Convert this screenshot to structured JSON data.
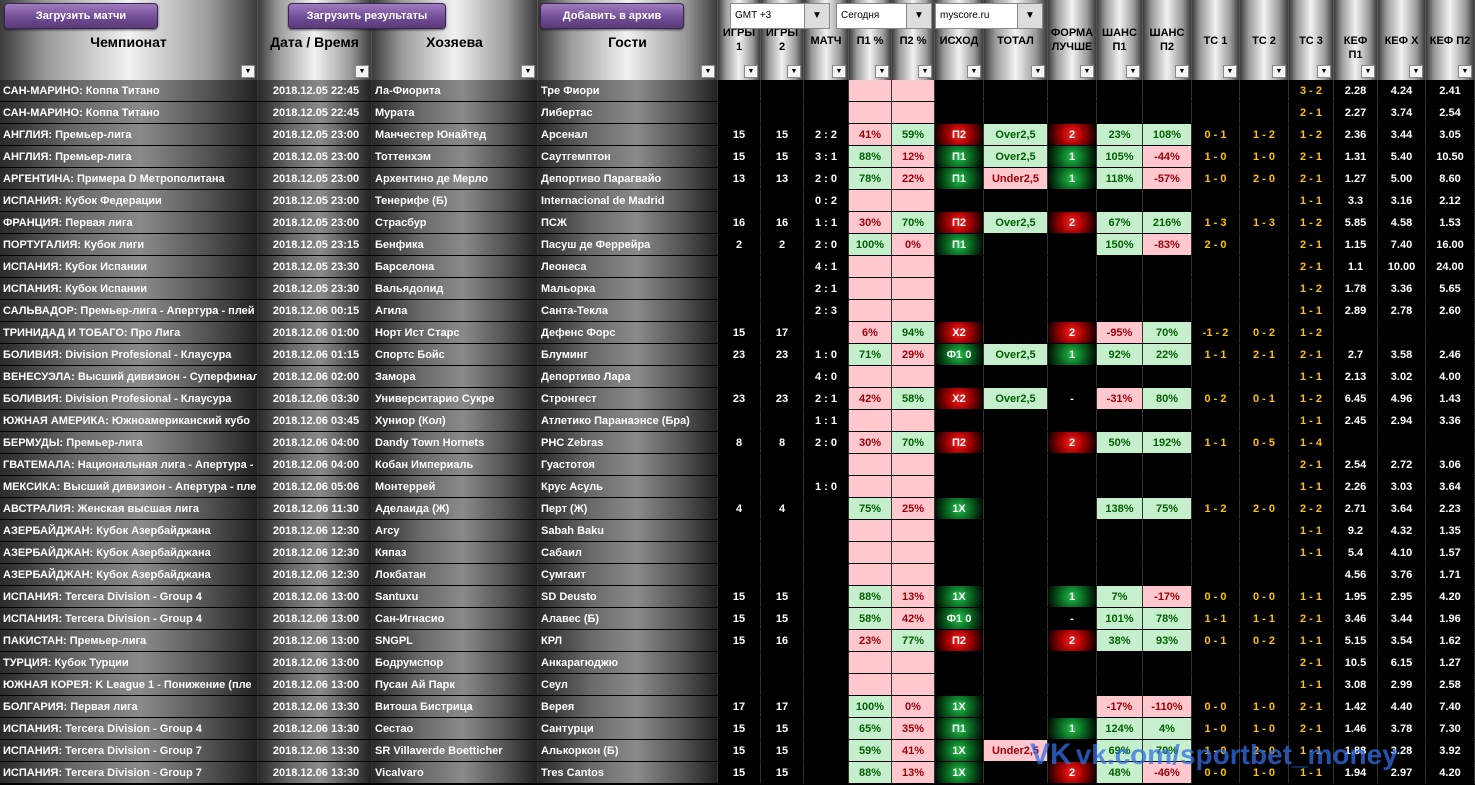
{
  "buttons": {
    "load_matches": "Загрузить матчи",
    "load_results": "Загрузить результаты",
    "archive": "Добавить в архив"
  },
  "dropdowns": {
    "timezone": "GMT +3",
    "day": "Сегодня",
    "source": "myscore.ru",
    "arrow": "▼"
  },
  "filter_glyph": "▼",
  "columns": [
    {
      "key": "champ",
      "label": "Чемпионат"
    },
    {
      "key": "date",
      "label": "Дата / Время"
    },
    {
      "key": "home",
      "label": "Хозяева"
    },
    {
      "key": "away",
      "label": "Гости"
    },
    {
      "key": "g1",
      "label": "ИГРЫ 1"
    },
    {
      "key": "g2",
      "label": "ИГРЫ 2"
    },
    {
      "key": "match",
      "label": "МАТЧ"
    },
    {
      "key": "p1",
      "label": "П1 %"
    },
    {
      "key": "p2",
      "label": "П2 %"
    },
    {
      "key": "out",
      "label": "ИСХОД"
    },
    {
      "key": "total",
      "label": "ТОТАЛ"
    },
    {
      "key": "form",
      "label": "ФОРМА ЛУЧШЕ"
    },
    {
      "key": "ch1",
      "label": "ШАНС П1"
    },
    {
      "key": "ch2",
      "label": "ШАНС П2"
    },
    {
      "key": "ts1",
      "label": "ТС 1"
    },
    {
      "key": "ts2",
      "label": "ТС 2"
    },
    {
      "key": "ts3",
      "label": "ТС 3"
    },
    {
      "key": "k1",
      "label": "КЕФ П1"
    },
    {
      "key": "kx",
      "label": "КЕФ Х"
    },
    {
      "key": "k2",
      "label": "КЕФ П2"
    }
  ],
  "rows": [
    {
      "champ": "САН-МАРИНО: Коппа Титано",
      "date": "2018.12.05 22:45",
      "home": "Ла-Фиорита",
      "away": "Тре Фиори",
      "g1": "",
      "g2": "",
      "match": "",
      "p1": "",
      "p2": "",
      "out": "",
      "total": "",
      "form": "",
      "ch1": "",
      "ch2": "",
      "ts1": "",
      "ts2": "",
      "ts3": "3 - 2",
      "k1": "2.28",
      "kx": "4.24",
      "k2": "2.41"
    },
    {
      "champ": "САН-МАРИНО: Коппа Титано",
      "date": "2018.12.05 22:45",
      "home": "Мурата",
      "away": "Либертас",
      "g1": "",
      "g2": "",
      "match": "",
      "p1": "",
      "p2": "",
      "out": "",
      "total": "",
      "form": "",
      "ch1": "",
      "ch2": "",
      "ts1": "",
      "ts2": "",
      "ts3": "2 - 1",
      "k1": "2.27",
      "kx": "3.74",
      "k2": "2.54"
    },
    {
      "champ": "АНГЛИЯ: Премьер-лига",
      "date": "2018.12.05 23:00",
      "home": "Манчестер Юнайтед",
      "away": "Арсенал",
      "g1": "15",
      "g2": "15",
      "match": "2 : 2",
      "p1": "41%",
      "p2": "59%",
      "out": "П2",
      "total": "Over2,5",
      "form": "2",
      "ch1": "23%",
      "ch2": "108%",
      "ts1": "0 - 1",
      "ts2": "1 - 2",
      "ts3": "1 - 2",
      "k1": "2.36",
      "kx": "3.44",
      "k2": "3.05"
    },
    {
      "champ": "АНГЛИЯ: Премьер-лига",
      "date": "2018.12.05 23:00",
      "home": "Тоттенхэм",
      "away": "Саутгемптон",
      "g1": "15",
      "g2": "15",
      "match": "3 : 1",
      "p1": "88%",
      "p2": "12%",
      "out": "П1",
      "total": "Over2,5",
      "form": "1",
      "ch1": "105%",
      "ch2": "-44%",
      "ts1": "1 - 0",
      "ts2": "1 - 0",
      "ts3": "2 - 1",
      "k1": "1.31",
      "kx": "5.40",
      "k2": "10.50"
    },
    {
      "champ": "АРГЕНТИНА: Примера D Метрополитана",
      "date": "2018.12.05 23:00",
      "home": "Архентино де Мерло",
      "away": "Депортиво Парагвайо",
      "g1": "13",
      "g2": "13",
      "match": "2 : 0",
      "p1": "78%",
      "p2": "22%",
      "out": "П1",
      "total": "Under2,5",
      "form": "1",
      "ch1": "118%",
      "ch2": "-57%",
      "ts1": "1 - 0",
      "ts2": "2 - 0",
      "ts3": "2 - 1",
      "k1": "1.27",
      "kx": "5.00",
      "k2": "8.60"
    },
    {
      "champ": "ИСПАНИЯ: Кубок Федерации",
      "date": "2018.12.05 23:00",
      "home": "Тенерифе (Б)",
      "away": "Internacional de Madrid",
      "g1": "",
      "g2": "",
      "match": "0 : 2",
      "p1": "",
      "p2": "",
      "out": "",
      "total": "",
      "form": "",
      "ch1": "",
      "ch2": "",
      "ts1": "",
      "ts2": "",
      "ts3": "1 - 1",
      "k1": "3.3",
      "kx": "3.16",
      "k2": "2.12"
    },
    {
      "champ": "ФРАНЦИЯ: Первая лига",
      "date": "2018.12.05 23:00",
      "home": "Страсбур",
      "away": "ПСЖ",
      "g1": "16",
      "g2": "16",
      "match": "1 : 1",
      "p1": "30%",
      "p2": "70%",
      "out": "П2",
      "total": "Over2,5",
      "form": "2",
      "ch1": "67%",
      "ch2": "216%",
      "ts1": "1 - 3",
      "ts2": "1 - 3",
      "ts3": "1 - 2",
      "k1": "5.85",
      "kx": "4.58",
      "k2": "1.53"
    },
    {
      "champ": "ПОРТУГАЛИЯ: Кубок лиги",
      "date": "2018.12.05 23:15",
      "home": "Бенфика",
      "away": "Пасуш де Феррейра",
      "g1": "2",
      "g2": "2",
      "match": "2 : 0",
      "p1": "100%",
      "p2": "0%",
      "out": "П1",
      "total": "",
      "form": "",
      "ch1": "150%",
      "ch2": "-83%",
      "ts1": "2 - 0",
      "ts2": "",
      "ts3": "2 - 1",
      "k1": "1.15",
      "kx": "7.40",
      "k2": "16.00"
    },
    {
      "champ": "ИСПАНИЯ: Кубок Испании",
      "date": "2018.12.05 23:30",
      "home": "Барселона",
      "away": "Леонеса",
      "g1": "",
      "g2": "",
      "match": "4 : 1",
      "p1": "",
      "p2": "",
      "out": "",
      "total": "",
      "form": "",
      "ch1": "",
      "ch2": "",
      "ts1": "",
      "ts2": "",
      "ts3": "2 - 1",
      "k1": "1.1",
      "kx": "10.00",
      "k2": "24.00"
    },
    {
      "champ": "ИСПАНИЯ: Кубок Испании",
      "date": "2018.12.05 23:30",
      "home": "Вальядолид",
      "away": "Мальорка",
      "g1": "",
      "g2": "",
      "match": "2 : 1",
      "p1": "",
      "p2": "",
      "out": "",
      "total": "",
      "form": "",
      "ch1": "",
      "ch2": "",
      "ts1": "",
      "ts2": "",
      "ts3": "1 - 2",
      "k1": "1.78",
      "kx": "3.36",
      "k2": "5.65"
    },
    {
      "champ": "САЛЬВАДОР: Премьер-лига - Апертура - плей",
      "date": "2018.12.06 00:15",
      "home": "Агила",
      "away": "Санта-Текла",
      "g1": "",
      "g2": "",
      "match": "2 : 3",
      "p1": "",
      "p2": "",
      "out": "",
      "total": "",
      "form": "",
      "ch1": "",
      "ch2": "",
      "ts1": "",
      "ts2": "",
      "ts3": "1 - 1",
      "k1": "2.89",
      "kx": "2.78",
      "k2": "2.60"
    },
    {
      "champ": "ТРИНИДАД И ТОБАГО: Про Лига",
      "date": "2018.12.06 01:00",
      "home": "Норт Ист Старс",
      "away": "Дефенс Форс",
      "g1": "15",
      "g2": "17",
      "match": "",
      "p1": "6%",
      "p2": "94%",
      "out": "Х2",
      "total": "",
      "form": "2",
      "ch1": "-95%",
      "ch2": "70%",
      "ts1": "-1 - 2",
      "ts2": "0 - 2",
      "ts3": "1 - 2",
      "k1": "",
      "kx": "",
      "k2": ""
    },
    {
      "champ": "БОЛИВИЯ: Division Profesional - Клаусура",
      "date": "2018.12.06 01:15",
      "home": "Спортс Бойс",
      "away": "Блуминг",
      "g1": "23",
      "g2": "23",
      "match": "1 : 0",
      "p1": "71%",
      "p2": "29%",
      "out": "Ф1 0",
      "total": "Over2,5",
      "form": "1",
      "ch1": "92%",
      "ch2": "22%",
      "ts1": "1 - 1",
      "ts2": "2 - 1",
      "ts3": "2 - 1",
      "k1": "2.7",
      "kx": "3.58",
      "k2": "2.46"
    },
    {
      "champ": "ВЕНЕСУЭЛА: Высший дивизион - Суперфинал",
      "date": "2018.12.06 02:00",
      "home": "Замора",
      "away": "Депортиво Лара",
      "g1": "",
      "g2": "",
      "match": "4 : 0",
      "p1": "",
      "p2": "",
      "out": "",
      "total": "",
      "form": "",
      "ch1": "",
      "ch2": "",
      "ts1": "",
      "ts2": "",
      "ts3": "1 - 1",
      "k1": "2.13",
      "kx": "3.02",
      "k2": "4.00"
    },
    {
      "champ": "БОЛИВИЯ: Division Profesional - Клаусура",
      "date": "2018.12.06 03:30",
      "home": "Университарио Сукре",
      "away": "Стронгест",
      "g1": "23",
      "g2": "23",
      "match": "2 : 1",
      "p1": "42%",
      "p2": "58%",
      "out": "Х2",
      "total": "Over2,5",
      "form": "-",
      "ch1": "-31%",
      "ch2": "80%",
      "ts1": "0 - 2",
      "ts2": "0 - 1",
      "ts3": "1 - 2",
      "k1": "6.45",
      "kx": "4.96",
      "k2": "1.43"
    },
    {
      "champ": "ЮЖНАЯ АМЕРИКА: Южноамериканский кубо",
      "date": "2018.12.06 03:45",
      "home": "Хуниор (Кол)",
      "away": "Атлетико Паранаэнсе (Бра)",
      "g1": "",
      "g2": "",
      "match": "1 : 1",
      "p1": "",
      "p2": "",
      "out": "",
      "total": "",
      "form": "",
      "ch1": "",
      "ch2": "",
      "ts1": "",
      "ts2": "",
      "ts3": "1 - 1",
      "k1": "2.45",
      "kx": "2.94",
      "k2": "3.36"
    },
    {
      "champ": "БЕРМУДЫ: Премьер-лига",
      "date": "2018.12.06 04:00",
      "home": "Dandy Town Hornets",
      "away": "PHC Zebras",
      "g1": "8",
      "g2": "8",
      "match": "2 : 0",
      "p1": "30%",
      "p2": "70%",
      "out": "П2",
      "total": "",
      "form": "2",
      "ch1": "50%",
      "ch2": "192%",
      "ts1": "1 - 1",
      "ts2": "0 - 5",
      "ts3": "1 - 4",
      "k1": "",
      "kx": "",
      "k2": ""
    },
    {
      "champ": "ГВАТЕМАЛА: Национальная лига - Апертура -",
      "date": "2018.12.06 04:00",
      "home": "Кобан Империаль",
      "away": "Гуастотоя",
      "g1": "",
      "g2": "",
      "match": "",
      "p1": "",
      "p2": "",
      "out": "",
      "total": "",
      "form": "",
      "ch1": "",
      "ch2": "",
      "ts1": "",
      "ts2": "",
      "ts3": "2 - 1",
      "k1": "2.54",
      "kx": "2.72",
      "k2": "3.06"
    },
    {
      "champ": "МЕКСИКА: Высший дивизион - Апертура - пле",
      "date": "2018.12.06 05:06",
      "home": "Монтеррей",
      "away": "Крус Асуль",
      "g1": "",
      "g2": "",
      "match": "1 : 0",
      "p1": "",
      "p2": "",
      "out": "",
      "total": "",
      "form": "",
      "ch1": "",
      "ch2": "",
      "ts1": "",
      "ts2": "",
      "ts3": "1 - 1",
      "k1": "2.26",
      "kx": "3.03",
      "k2": "3.64"
    },
    {
      "champ": "АВСТРАЛИЯ: Женская высшая лига",
      "date": "2018.12.06 11:30",
      "home": "Аделаида (Ж)",
      "away": "Перт (Ж)",
      "g1": "4",
      "g2": "4",
      "match": "",
      "p1": "75%",
      "p2": "25%",
      "out": "1Х",
      "total": "",
      "form": "",
      "ch1": "138%",
      "ch2": "75%",
      "ts1": "1 - 2",
      "ts2": "2 - 0",
      "ts3": "2 - 2",
      "k1": "2.71",
      "kx": "3.64",
      "k2": "2.23"
    },
    {
      "champ": "АЗЕРБАЙДЖАН: Кубок Азербайджана",
      "date": "2018.12.06 12:30",
      "home": "Arcy",
      "away": "Sabah Baku",
      "g1": "",
      "g2": "",
      "match": "",
      "p1": "",
      "p2": "",
      "out": "",
      "total": "",
      "form": "",
      "ch1": "",
      "ch2": "",
      "ts1": "",
      "ts2": "",
      "ts3": "1 - 1",
      "k1": "9.2",
      "kx": "4.32",
      "k2": "1.35"
    },
    {
      "champ": "АЗЕРБАЙДЖАН: Кубок Азербайджана",
      "date": "2018.12.06 12:30",
      "home": "Кяпаз",
      "away": "Сабаил",
      "g1": "",
      "g2": "",
      "match": "",
      "p1": "",
      "p2": "",
      "out": "",
      "total": "",
      "form": "",
      "ch1": "",
      "ch2": "",
      "ts1": "",
      "ts2": "",
      "ts3": "1 - 1",
      "k1": "5.4",
      "kx": "4.10",
      "k2": "1.57"
    },
    {
      "champ": "АЗЕРБАЙДЖАН: Кубок Азербайджана",
      "date": "2018.12.06 12:30",
      "home": "Локбатан",
      "away": "Сумгаит",
      "g1": "",
      "g2": "",
      "match": "",
      "p1": "",
      "p2": "",
      "out": "",
      "total": "",
      "form": "",
      "ch1": "",
      "ch2": "",
      "ts1": "",
      "ts2": "",
      "ts3": "",
      "k1": "4.56",
      "kx": "3.76",
      "k2": "1.71"
    },
    {
      "champ": "ИСПАНИЯ: Tercera Division - Group 4",
      "date": "2018.12.06 13:00",
      "home": "Santuxu",
      "away": "SD Deusto",
      "g1": "15",
      "g2": "15",
      "match": "",
      "p1": "88%",
      "p2": "13%",
      "out": "1Х",
      "total": "",
      "form": "1",
      "ch1": "7%",
      "ch2": "-17%",
      "ts1": "0 - 0",
      "ts2": "0 - 0",
      "ts3": "1 - 1",
      "k1": "1.95",
      "kx": "2.95",
      "k2": "4.20"
    },
    {
      "champ": "ИСПАНИЯ: Tercera Division - Group 4",
      "date": "2018.12.06 13:00",
      "home": "Сан-Игнасио",
      "away": "Алавес (Б)",
      "g1": "15",
      "g2": "15",
      "match": "",
      "p1": "58%",
      "p2": "42%",
      "out": "Ф1 0",
      "total": "",
      "form": "-",
      "ch1": "101%",
      "ch2": "78%",
      "ts1": "1 - 1",
      "ts2": "1 - 1",
      "ts3": "2 - 1",
      "k1": "3.46",
      "kx": "3.44",
      "k2": "1.96"
    },
    {
      "champ": "ПАКИСТАН: Премьер-лига",
      "date": "2018.12.06 13:00",
      "home": "SNGPL",
      "away": "КРЛ",
      "g1": "15",
      "g2": "16",
      "match": "",
      "p1": "23%",
      "p2": "77%",
      "out": "П2",
      "total": "",
      "form": "2",
      "ch1": "38%",
      "ch2": "93%",
      "ts1": "0 - 1",
      "ts2": "0 - 2",
      "ts3": "1 - 1",
      "k1": "5.15",
      "kx": "3.54",
      "k2": "1.62"
    },
    {
      "champ": "ТУРЦИЯ: Кубок Турции",
      "date": "2018.12.06 13:00",
      "home": "Бодрумспор",
      "away": "Анкарагюджю",
      "g1": "",
      "g2": "",
      "match": "",
      "p1": "",
      "p2": "",
      "out": "",
      "total": "",
      "form": "",
      "ch1": "",
      "ch2": "",
      "ts1": "",
      "ts2": "",
      "ts3": "2 - 1",
      "k1": "10.5",
      "kx": "6.15",
      "k2": "1.27"
    },
    {
      "champ": "ЮЖНАЯ КОРЕЯ: K League 1 - Понижение (пле",
      "date": "2018.12.06 13:00",
      "home": "Пусан Ай Парк",
      "away": "Сеул",
      "g1": "",
      "g2": "",
      "match": "",
      "p1": "",
      "p2": "",
      "out": "",
      "total": "",
      "form": "",
      "ch1": "",
      "ch2": "",
      "ts1": "",
      "ts2": "",
      "ts3": "1 - 1",
      "k1": "3.08",
      "kx": "2.99",
      "k2": "2.58"
    },
    {
      "champ": "БОЛГАРИЯ: Первая лига",
      "date": "2018.12.06 13:30",
      "home": "Витоша Бистрица",
      "away": "Верея",
      "g1": "17",
      "g2": "17",
      "match": "",
      "p1": "100%",
      "p2": "0%",
      "out": "1Х",
      "total": "",
      "form": "",
      "ch1": "-17%",
      "ch2": "-110%",
      "ts1": "0 - 0",
      "ts2": "1 - 0",
      "ts3": "2 - 1",
      "k1": "1.42",
      "kx": "4.40",
      "k2": "7.40"
    },
    {
      "champ": "ИСПАНИЯ: Tercera Division - Group 4",
      "date": "2018.12.06 13:30",
      "home": "Сестао",
      "away": "Сантурци",
      "g1": "15",
      "g2": "15",
      "match": "",
      "p1": "65%",
      "p2": "35%",
      "out": "П1",
      "total": "",
      "form": "1",
      "ch1": "124%",
      "ch2": "4%",
      "ts1": "1 - 0",
      "ts2": "1 - 0",
      "ts3": "2 - 1",
      "k1": "1.46",
      "kx": "3.78",
      "k2": "7.30"
    },
    {
      "champ": "ИСПАНИЯ: Tercera Division - Group 7",
      "date": "2018.12.06 13:30",
      "home": "SR Villaverde Boetticher",
      "away": "Алькоркон (Б)",
      "g1": "15",
      "g2": "15",
      "match": "",
      "p1": "59%",
      "p2": "41%",
      "out": "1Х",
      "total": "Under2,5",
      "form": "",
      "ch1": "69%",
      "ch2": "70%",
      "ts1": "1 - 0",
      "ts2": "2 - 0",
      "ts3": "1 - 1",
      "k1": "1.88",
      "kx": "3.28",
      "k2": "3.92"
    },
    {
      "champ": "ИСПАНИЯ: Tercera Division - Group 7",
      "date": "2018.12.06 13:30",
      "home": "Vicalvaro",
      "away": "Tres Cantos",
      "g1": "15",
      "g2": "15",
      "match": "",
      "p1": "88%",
      "p2": "13%",
      "out": "1Х",
      "total": "",
      "form": "2",
      "ch1": "48%",
      "ch2": "-46%",
      "ts1": "0 - 0",
      "ts2": "1 - 0",
      "ts3": "1 - 1",
      "k1": "1.94",
      "kx": "2.97",
      "k2": "4.20"
    }
  ],
  "watermark": {
    "brand": "VK",
    "text": "vk.com/sportbet_money"
  },
  "colors": {
    "red_cell": "#ffc7ce",
    "green_cell": "#c6efce",
    "red_text": "#9c0006",
    "green_text": "#006100",
    "ts_text": "#ffc000",
    "button": "#7a559c"
  }
}
